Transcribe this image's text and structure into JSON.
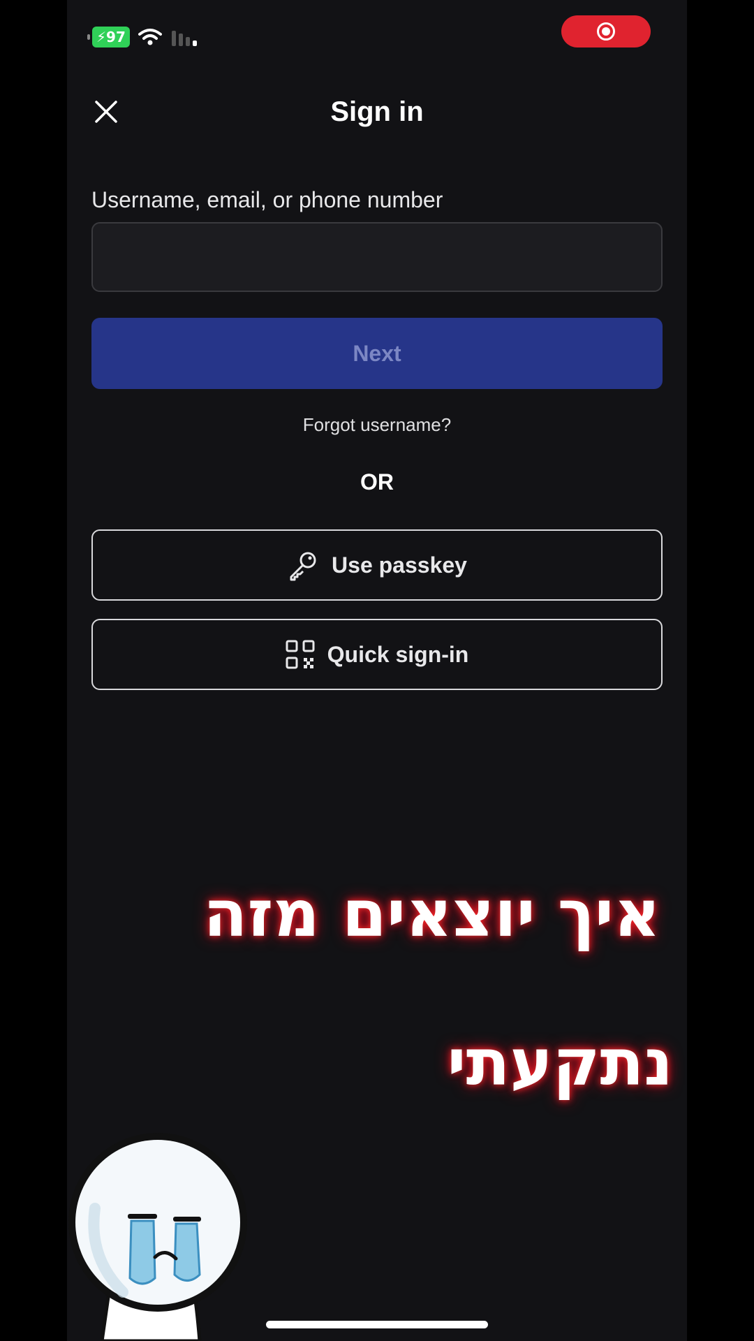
{
  "status_bar": {
    "battery": "97"
  },
  "header": {
    "title": "Sign in"
  },
  "form": {
    "label": "Username, email, or phone number",
    "input_value": "",
    "input_placeholder": "",
    "next_label": "Next",
    "forgot_label": "Forgot username?",
    "or_label": "OR"
  },
  "alternatives": {
    "passkey_label": "Use passkey",
    "quick_label": "Quick sign-in"
  },
  "overlay": {
    "line1": "איך יוצאים מזה",
    "line2": "נתקעתי"
  },
  "colors": {
    "background": "#121215",
    "next_button": "#263589",
    "record_button": "#e0232f",
    "battery": "#30d158"
  }
}
